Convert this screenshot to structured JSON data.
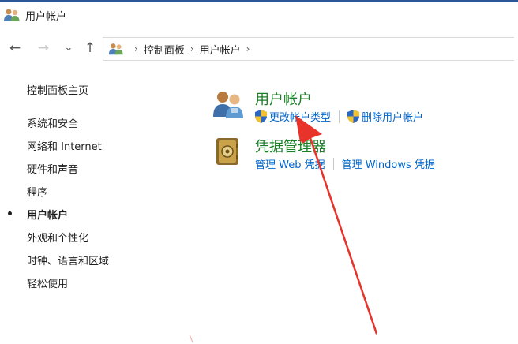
{
  "window": {
    "title": "用户帐户"
  },
  "nav": {
    "back_glyph": "←",
    "forward_glyph": "→",
    "recent_glyph": "⌄",
    "up_glyph": "↑"
  },
  "address": {
    "separator": "›",
    "crumbs": [
      "控制面板",
      "用户帐户"
    ]
  },
  "left_pane": {
    "home_label": "控制面板主页",
    "categories": [
      {
        "label": "系统和安全",
        "active": false
      },
      {
        "label": "网络和 Internet",
        "active": false
      },
      {
        "label": "硬件和声音",
        "active": false
      },
      {
        "label": "程序",
        "active": false
      },
      {
        "label": "用户帐户",
        "active": true
      },
      {
        "label": "外观和个性化",
        "active": false
      },
      {
        "label": "时钟、语言和区域",
        "active": false
      },
      {
        "label": "轻松使用",
        "active": false
      }
    ]
  },
  "groups": [
    {
      "title": "用户帐户",
      "icon": "user-accounts-icon",
      "links": [
        {
          "label": "更改帐户类型",
          "shield": true
        },
        {
          "label": "删除用户帐户",
          "shield": true
        }
      ]
    },
    {
      "title": "凭据管理器",
      "icon": "credential-manager-icon",
      "links": [
        {
          "label": "管理 Web 凭据",
          "shield": false
        },
        {
          "label": "管理 Windows 凭据",
          "shield": false
        }
      ]
    }
  ],
  "colors": {
    "group_title": "#1a7f25",
    "link": "#0066cc",
    "arrow": "#e8332a"
  }
}
